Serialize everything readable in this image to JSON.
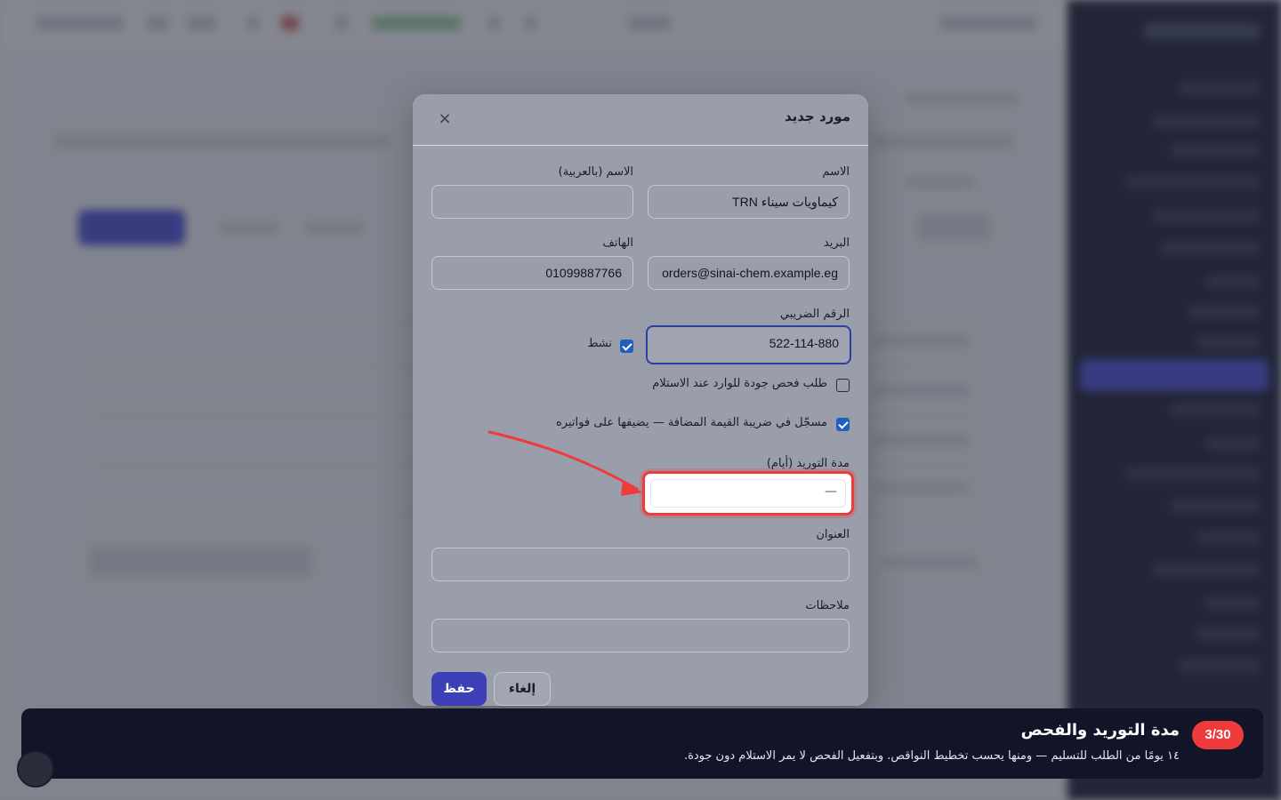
{
  "modal": {
    "title": "مورد جديد",
    "close_symbol": "×",
    "fields": {
      "name_label": "الاسم",
      "name_value": "TRN كيماويات سيناء",
      "name_ar_label": "الاسم (بالعربية)",
      "name_ar_value": "",
      "email_label": "البريد",
      "email_value": "orders@sinai-chem.example.eg",
      "phone_label": "الهاتف",
      "phone_value": "01099887766",
      "tax_label": "الرقم الضريبي",
      "tax_value": "522-114-880",
      "lead_time_label": "مدة التوريد (أيام)",
      "lead_time_value": "—",
      "address_label": "العنوان",
      "address_value": "",
      "notes_label": "ملاحظات",
      "notes_value": ""
    },
    "checkboxes": {
      "active_label": "نشط",
      "active_checked": true,
      "qc_label": "طلب فحص جودة للوارد عند الاستلام",
      "qc_checked": false,
      "vat_label": "مسجّل في ضريبة القيمة المضافة — يضيفها على فواتيره",
      "vat_checked": true
    },
    "buttons": {
      "save": "حفظ",
      "cancel": "إلغاء"
    }
  },
  "tour": {
    "step": "3/30",
    "title": "مدة التوريد والفحص",
    "text": "١٤ يومًا من الطلب للتسليم — ومنها يحسب تخطيط النواقص. وبتفعيل الفحص لا يمر الاستلام دون جودة."
  },
  "colors": {
    "primary": "#3d3fb6",
    "highlight": "#ef3b3b",
    "checkbox": "#1f5fbf",
    "tour_bg": "#121528"
  }
}
